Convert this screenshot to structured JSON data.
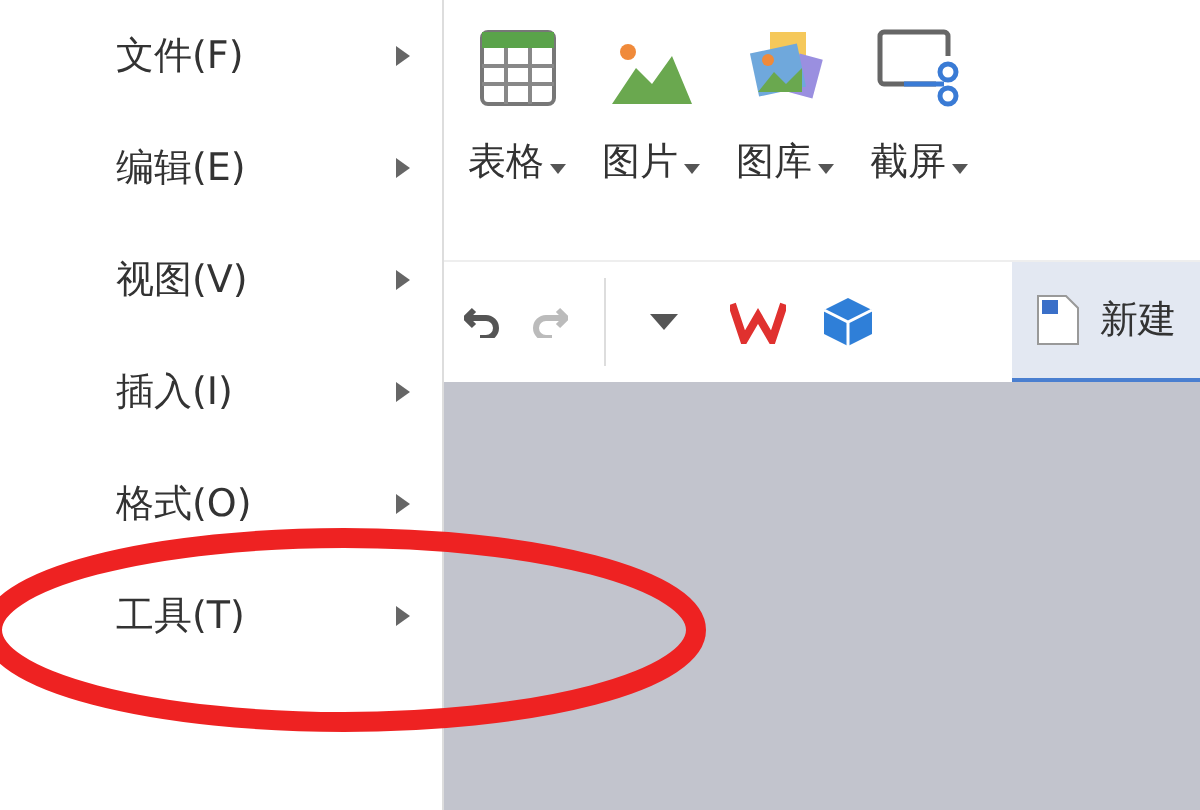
{
  "menu": {
    "items": [
      {
        "label": "文件(F)",
        "has_submenu": true
      },
      {
        "label": "编辑(E)",
        "has_submenu": true
      },
      {
        "label": "视图(V)",
        "has_submenu": true
      },
      {
        "label": "插入(I)",
        "has_submenu": true
      },
      {
        "label": "格式(O)",
        "has_submenu": true
      },
      {
        "label": "工具(T)",
        "has_submenu": true
      }
    ]
  },
  "ribbon": {
    "buttons": [
      {
        "kind": "table",
        "label": "表格"
      },
      {
        "kind": "picture",
        "label": "图片"
      },
      {
        "kind": "gallery",
        "label": "图库"
      },
      {
        "kind": "screenshot",
        "label": "截屏"
      }
    ]
  },
  "tab_bar": {
    "tabs": [
      {
        "label": "新建",
        "selected": true
      }
    ]
  }
}
